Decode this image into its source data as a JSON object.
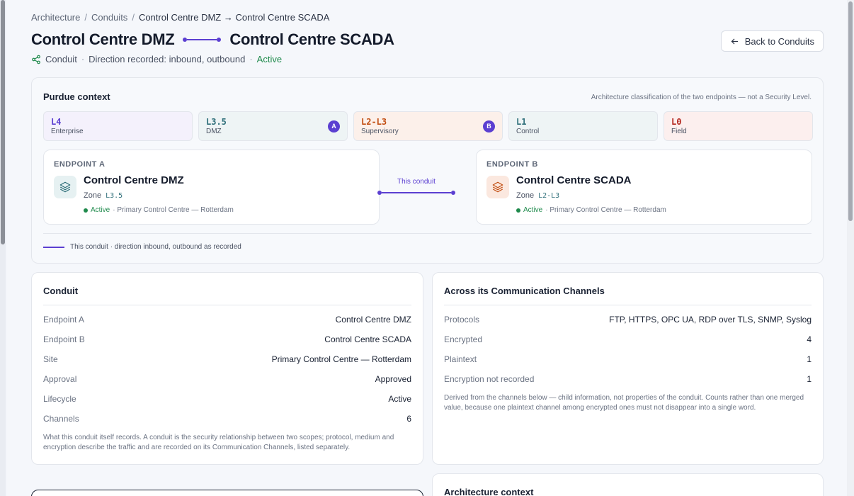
{
  "breadcrumb": [
    "Architecture",
    "Conduits",
    "Control Centre DMZ → Control Centre SCADA"
  ],
  "title": {
    "left": "Control Centre DMZ",
    "right": "Control Centre SCADA"
  },
  "meta": {
    "type": "Conduit",
    "direction": "Direction recorded: inbound, outbound",
    "status": "Active"
  },
  "back_label": "Back to Conduits",
  "purdue": {
    "heading": "Purdue context",
    "note": "Architecture classification of the two endpoints — not a Security Level.",
    "levels": [
      {
        "code": "L4",
        "label": "Enterprise",
        "badge": "",
        "color": "#5b3fd1",
        "bg": "#f4f1fc"
      },
      {
        "code": "L3.5",
        "label": "DMZ",
        "badge": "A",
        "color": "#2f6f7a",
        "bg": "#eef4f5"
      },
      {
        "code": "L2-L3",
        "label": "Supervisory",
        "badge": "B",
        "color": "#c24e12",
        "bg": "#fcf0ea"
      },
      {
        "code": "L1",
        "label": "Control",
        "badge": "",
        "color": "#2f6f7a",
        "bg": "#eef4f5"
      },
      {
        "code": "L0",
        "label": "Field",
        "badge": "",
        "color": "#b3261e",
        "bg": "#fcefee"
      }
    ],
    "endpoint_a": {
      "caption": "ENDPOINT A",
      "name": "Control Centre DMZ",
      "zone_label": "Zone",
      "zone": "L3.5",
      "status": "Active",
      "site": "· Primary Control Centre — Rotterdam"
    },
    "endpoint_b": {
      "caption": "ENDPOINT B",
      "name": "Control Centre SCADA",
      "zone_label": "Zone",
      "zone": "L2-L3",
      "status": "Active",
      "site": "· Primary Control Centre — Rotterdam"
    },
    "conduit_label": "This conduit",
    "legend": "This conduit · direction inbound, outbound as recorded"
  },
  "conduit": {
    "heading": "Conduit",
    "rows": [
      {
        "k": "Endpoint A",
        "v": "Control Centre DMZ"
      },
      {
        "k": "Endpoint B",
        "v": "Control Centre SCADA"
      },
      {
        "k": "Site",
        "v": "Primary Control Centre — Rotterdam"
      },
      {
        "k": "Approval",
        "v": "Approved"
      },
      {
        "k": "Lifecycle",
        "v": "Active"
      },
      {
        "k": "Channels",
        "v": "6"
      }
    ],
    "foot": "What this conduit itself records. A conduit is the security relationship between two scopes; protocol, medium and encryption describe the traffic and are recorded on its Communication Channels, listed separately."
  },
  "channels": {
    "heading": "Across its Communication Channels",
    "rows": [
      {
        "k": "Protocols",
        "v": "FTP, HTTPS, OPC UA, RDP over TLS, SNMP, Syslog"
      },
      {
        "k": "Encrypted",
        "v": "4"
      },
      {
        "k": "Plaintext",
        "v": "1"
      },
      {
        "k": "Encryption not recorded",
        "v": "1"
      }
    ],
    "foot": "Derived from the channels below — child information, not properties of the conduit. Counts rather than one merged value, because one plaintext channel among encrypted ones must not disappear into a single word."
  },
  "architecture": {
    "heading": "Architecture context"
  }
}
